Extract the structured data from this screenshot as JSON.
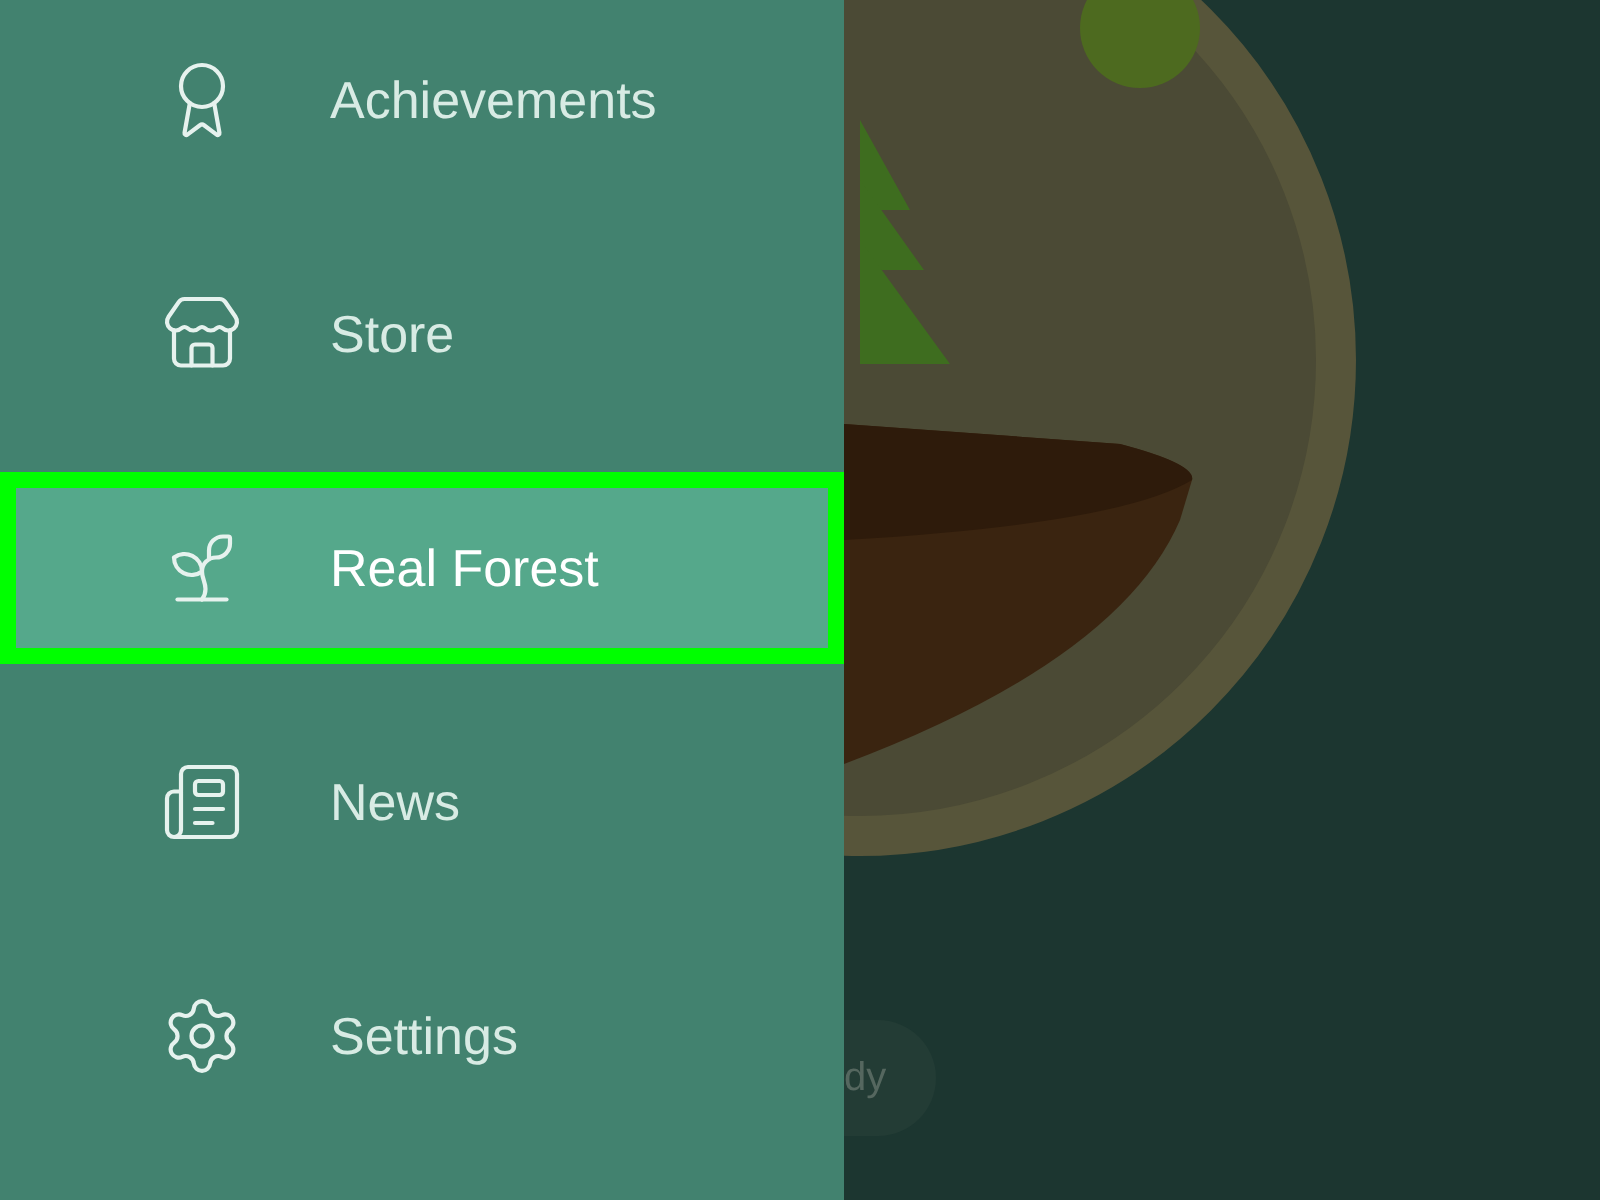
{
  "menu": {
    "items": [
      {
        "label": "Achievements",
        "kind": "award",
        "selected": false
      },
      {
        "label": "Store",
        "kind": "store",
        "selected": false
      },
      {
        "label": "Real Forest",
        "kind": "sprout",
        "selected": true
      },
      {
        "label": "News",
        "kind": "news",
        "selected": false
      },
      {
        "label": "Settings",
        "kind": "settings",
        "selected": false
      }
    ]
  },
  "background": {
    "button_text": "dy"
  }
}
